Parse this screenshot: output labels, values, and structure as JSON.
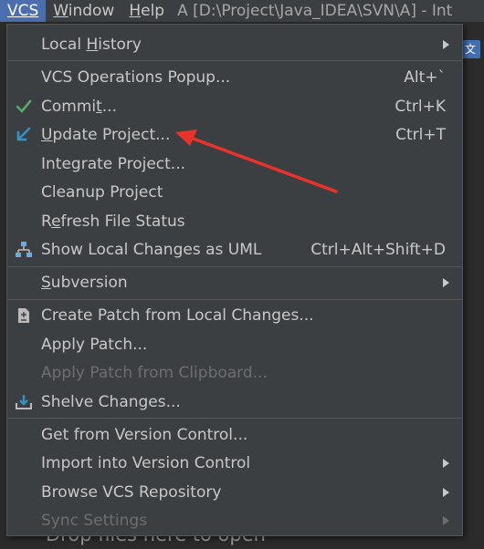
{
  "menubar": {
    "vcs": "VCS",
    "window_prefix": "W",
    "window_rest": "indow",
    "help_prefix": "H",
    "help_rest": "elp",
    "title": "A [D:\\Project\\Java_IDEA\\SVN\\A] - Int"
  },
  "editor": {
    "drop_hint": "Drop files here to open"
  },
  "menu": {
    "local_history": {
      "pre": "Local ",
      "u": "H",
      "post": "istory"
    },
    "vcs_operations": {
      "label": "VCS Operations Popup...",
      "shortcut": "Alt+`"
    },
    "commit": {
      "pre": "Commi",
      "u": "t",
      "post": "...",
      "shortcut": "Ctrl+K"
    },
    "update_project": {
      "pre": "",
      "u": "U",
      "post": "pdate Project...",
      "shortcut": "Ctrl+T"
    },
    "integrate_project": {
      "label": "Integrate Project..."
    },
    "cleanup_project": {
      "label": "Cleanup Project"
    },
    "refresh_status": {
      "pre": "R",
      "u": "e",
      "post": "fresh File Status"
    },
    "show_local_changes": {
      "label": "Show Local Changes as UML",
      "shortcut": "Ctrl+Alt+Shift+D"
    },
    "subversion": {
      "pre": "",
      "u": "S",
      "post": "ubversion"
    },
    "create_patch": {
      "label": "Create Patch from Local Changes..."
    },
    "apply_patch": {
      "label": "Apply Patch..."
    },
    "apply_patch_clipboard": {
      "label": "Apply Patch from Clipboard..."
    },
    "shelve_changes": {
      "label": "Shelve Changes..."
    },
    "get_from_vc": {
      "label": "Get from Version Control..."
    },
    "import_into_vc": {
      "label": "Import into Version Control"
    },
    "browse_vcs": {
      "label": "Browse VCS Repository"
    },
    "sync_settings": {
      "label": "Sync Settings"
    }
  },
  "colors": {
    "menu_bg": "#3c3f41",
    "selected_menu": "#4b6eaf",
    "commit_check": "#59a869",
    "update_arrow": "#3592c4",
    "annotation_arrow": "#e8322b"
  },
  "icons": [
    "check-icon",
    "update-arrow-icon",
    "uml-diagram-icon",
    "patch-file-icon",
    "shelve-icon",
    "submenu-arrow-icon"
  ]
}
